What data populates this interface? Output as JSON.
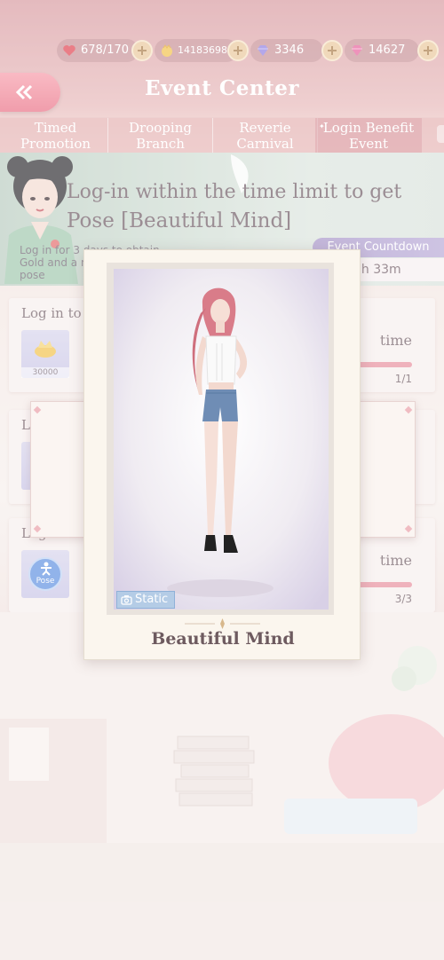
{
  "currency": {
    "stamina": "678/170",
    "gold": "14183698",
    "diamonds": "3346",
    "pink_diamonds": "14627"
  },
  "header": {
    "title": "Event Center"
  },
  "tabs": [
    {
      "label": "Timed Promotion"
    },
    {
      "label": "Drooping Branch"
    },
    {
      "label": "Reverie Carnival"
    },
    {
      "label": "Login Benefit Event"
    }
  ],
  "banner": {
    "heading_line1": "Log-in within the time limit to get",
    "heading_line2": "Pose [Beautiful Mind]",
    "desc": "Log in for 3 days to obtain Gold and a new static pose",
    "countdown_label": "Event Countdown",
    "countdown_value": "6h 33m"
  },
  "tasks": [
    {
      "title": "Log in to the",
      "reward_count": "30000",
      "status": "time",
      "progress": "1/1",
      "progress_fraction": 1.0
    },
    {
      "title": "L"
    },
    {
      "title": "Log in to",
      "reward_label": "Pose",
      "status": "time",
      "progress": "3/3",
      "progress_fraction": 1.0
    }
  ],
  "pose_card": {
    "badge": "Static",
    "name": "Beautiful Mind"
  },
  "colors": {
    "accent_pink": "#e96f84",
    "countdown_purple": "#a795c9",
    "progress_fill": "#e88e9c",
    "text_brown": "#6d5a62"
  }
}
